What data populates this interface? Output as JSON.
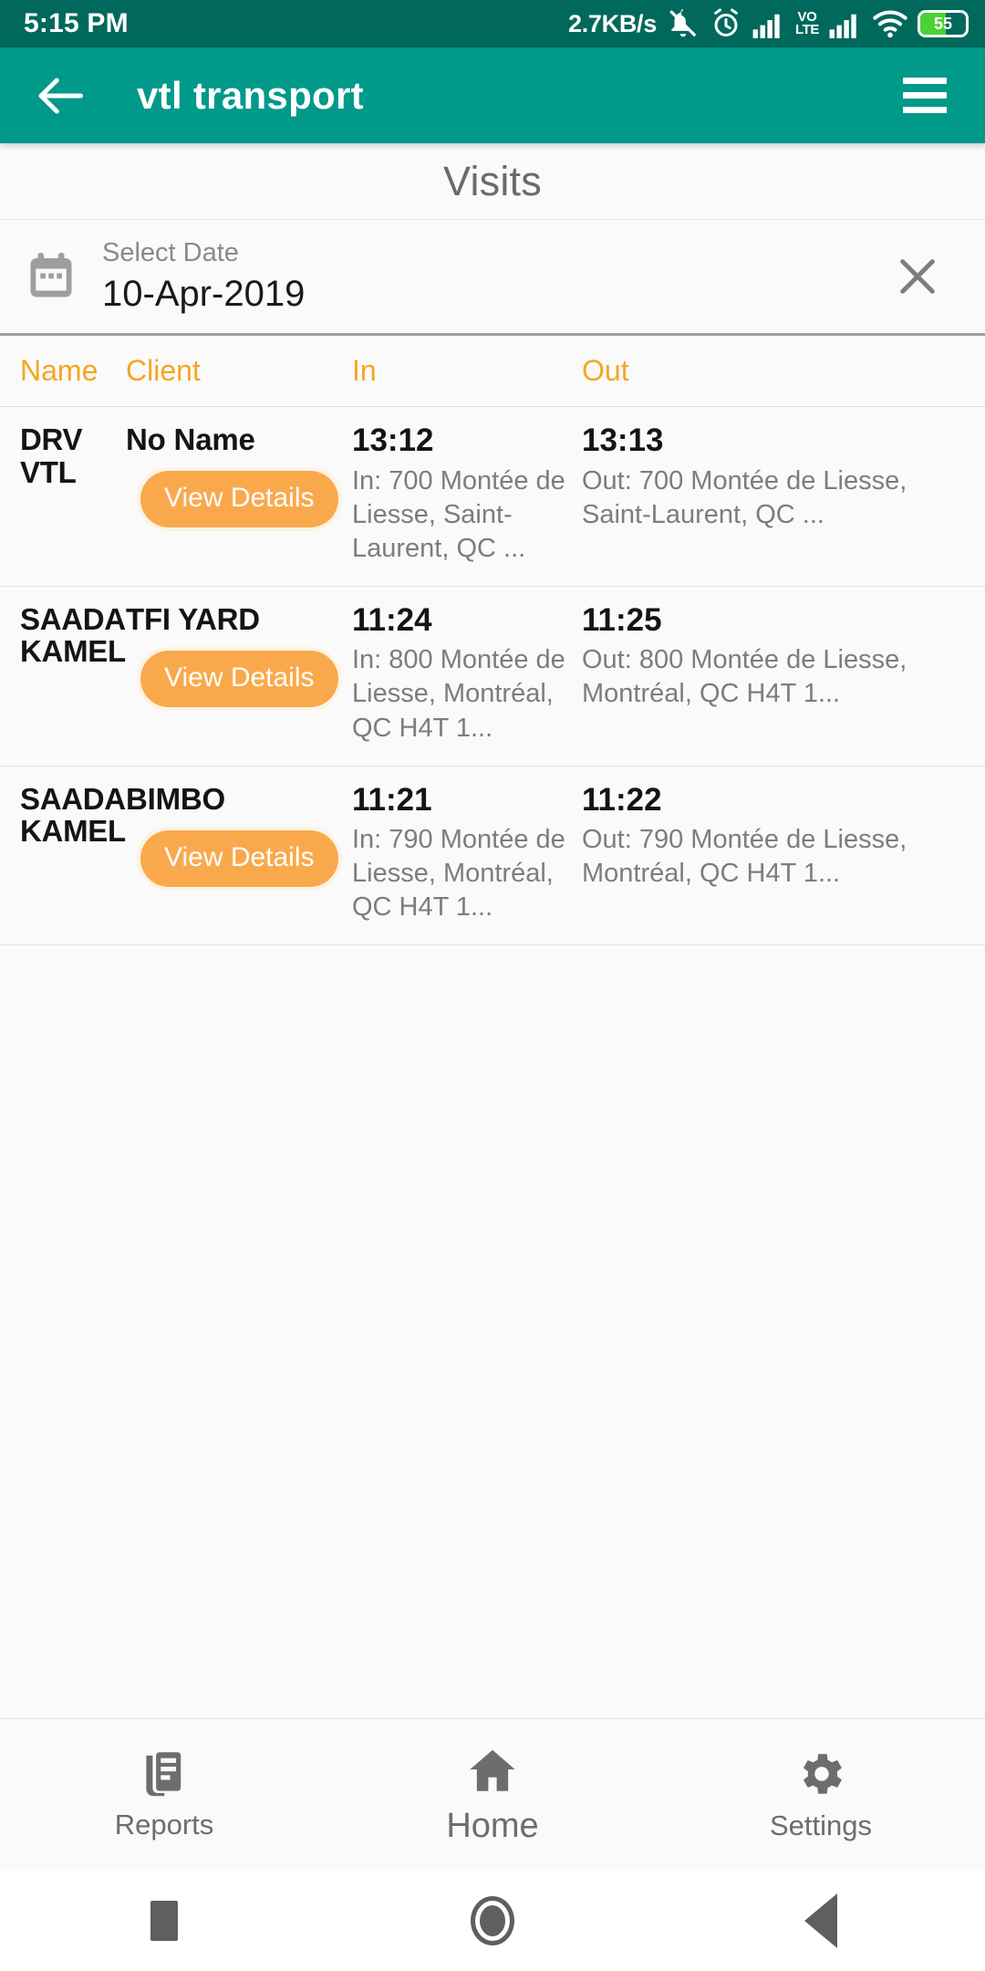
{
  "status_bar": {
    "clock": "5:15 PM",
    "network_speed": "2.7KB/s",
    "volte_top": "VO",
    "volte_bottom": "LTE",
    "battery_percent": "55",
    "icons": [
      "mute-icon",
      "alarm-icon",
      "signal-icon",
      "volte-icon",
      "signal-icon",
      "wifi-icon",
      "battery-icon"
    ],
    "background": "#00695C"
  },
  "app_bar": {
    "title": "vtl transport",
    "back_icon": "arrow-left-icon",
    "menu_icon": "hamburger-menu-icon",
    "background": "#00998A"
  },
  "page": {
    "title": "Visits"
  },
  "date_filter": {
    "icon": "calendar-icon",
    "label": "Select Date",
    "value": "10-Apr-2019",
    "clear_icon": "close-icon"
  },
  "table": {
    "header_color": "#F5A623",
    "columns": [
      "Name",
      "Client",
      "In",
      "Out"
    ],
    "rows": [
      {
        "name": "DRV VTL",
        "client": "No Name",
        "details_label": "View Details",
        "in_time": "13:12",
        "in_address": "In: 700 Montée de Liesse, Saint-Laurent, QC ...",
        "out_time": "13:13",
        "out_address": "Out: 700 Montée de Liesse, Saint-Laurent, QC ..."
      },
      {
        "name": "SAADA KAMEL",
        "client": "TFI YARD",
        "details_label": "View Details",
        "in_time": "11:24",
        "in_address": "In: 800 Montée de Liesse, Montréal, QC H4T 1...",
        "out_time": "11:25",
        "out_address": "Out: 800 Montée de Liesse, Montréal, QC H4T 1..."
      },
      {
        "name": "SAADA KAMEL",
        "client": "BIMBO",
        "details_label": "View Details",
        "in_time": "11:21",
        "in_address": "In: 790 Montée de Liesse, Montréal, QC H4T 1...",
        "out_time": "11:22",
        "out_address": "Out: 790 Montée de Liesse, Montréal, QC H4T 1..."
      }
    ],
    "button_color": "#F9A94C"
  },
  "bottom_nav": {
    "items": [
      {
        "label": "Reports",
        "icon": "reports-icon"
      },
      {
        "label": "Home",
        "icon": "home-icon"
      },
      {
        "label": "Settings",
        "icon": "gear-icon"
      }
    ]
  },
  "system_nav": {
    "recents": "square-recents-icon",
    "home": "circle-home-icon",
    "back": "triangle-back-icon"
  }
}
